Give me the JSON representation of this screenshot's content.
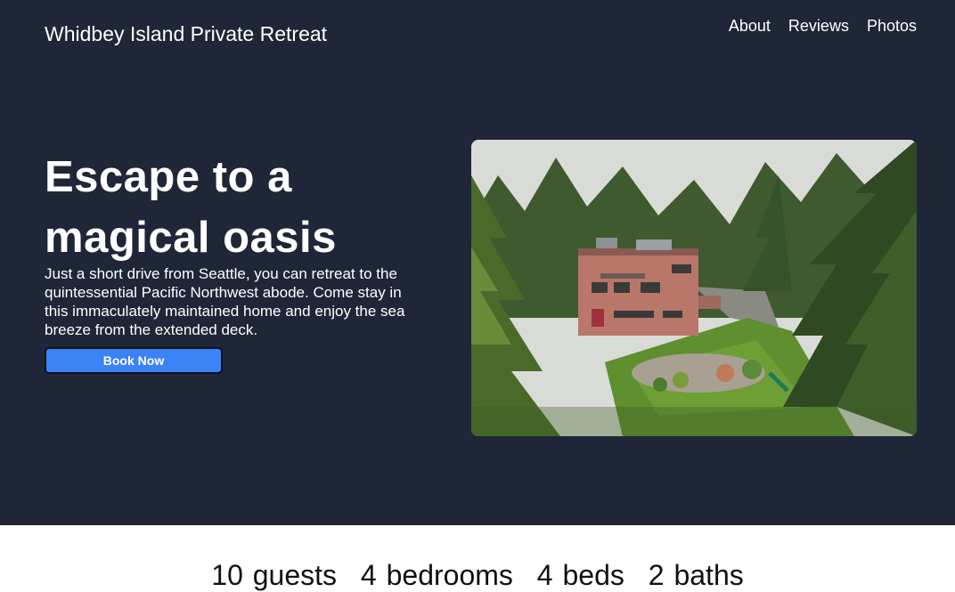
{
  "header": {
    "site_title": "Whidbey Island Private Retreat",
    "nav": [
      {
        "label": "About"
      },
      {
        "label": "Reviews"
      },
      {
        "label": "Photos"
      }
    ]
  },
  "hero": {
    "headline": "Escape to a magical oasis",
    "description": "Just a short drive from Seattle, you can retreat to the quintessential Pacific Northwest abode. Come stay in this immaculately maintained home and enjoy the sea breeze from the extended deck.",
    "book_button": "Book Now",
    "image_alt": "Aerial view of a pink multi-story house surrounded by evergreen trees and a landscaped garden"
  },
  "stats": {
    "guests": "10 guests",
    "bedrooms": "4 bedrooms",
    "beds": "4 beds",
    "baths": "2 baths"
  },
  "colors": {
    "hero_bg": "#1f2637",
    "button": "#3b82f6"
  }
}
